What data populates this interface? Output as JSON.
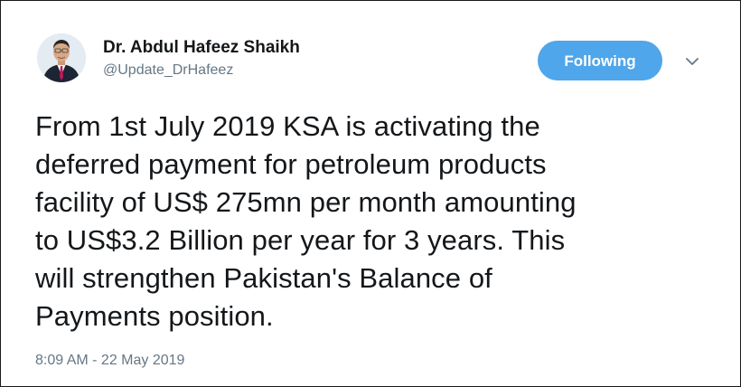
{
  "author": {
    "display_name": "Dr. Abdul Hafeez Shaikh",
    "handle": "@Update_DrHafeez"
  },
  "follow_button": {
    "label": "Following",
    "color": "#4fa6ea"
  },
  "menu_caret": {
    "icon": "chevron-down-icon"
  },
  "tweet": {
    "lines": [
      "From 1st July 2019 KSA is activating the",
      "deferred payment for petroleum products",
      "facility of US$ 275mn per month amounting",
      "to US$3.2 Billion per year for 3 years. This",
      "will strengthen Pakistan's Balance of",
      "Payments position."
    ],
    "timestamp": "8:09 AM - 22 May 2019"
  }
}
